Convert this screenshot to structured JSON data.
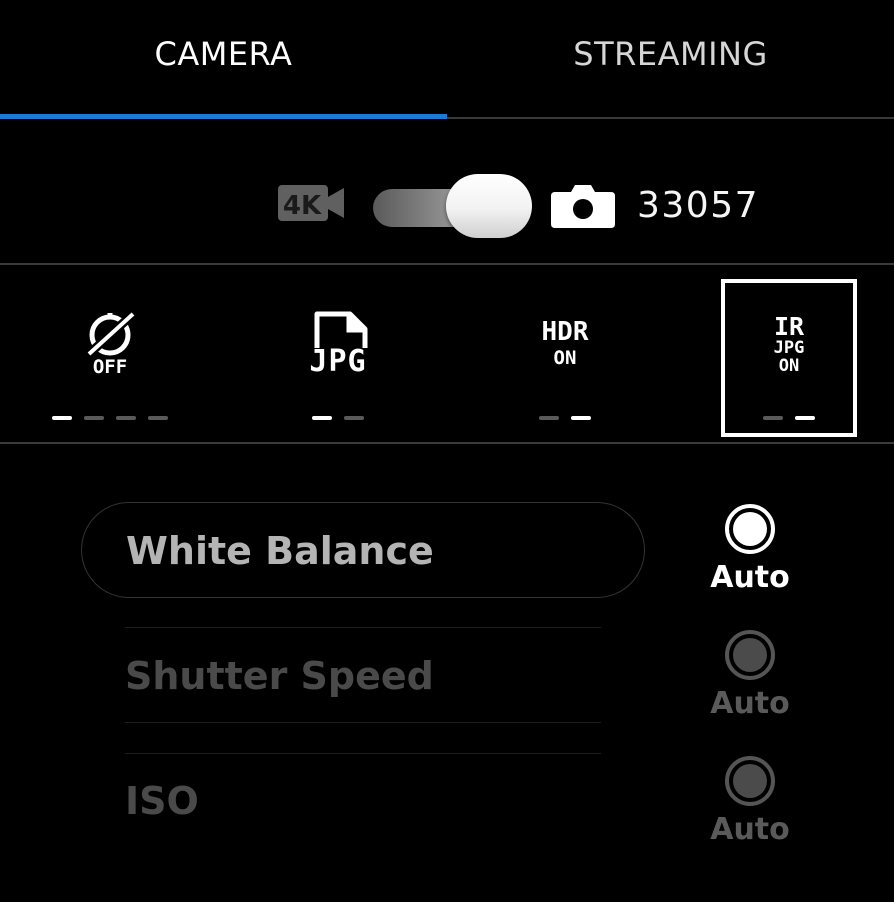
{
  "tabs": [
    {
      "label": "CAMERA",
      "active": true
    },
    {
      "label": "STREAMING",
      "active": false
    }
  ],
  "accent_color": "#1f7ad6",
  "mode": {
    "video_icon_label": "4K",
    "current": "photo",
    "shot_count": "33057"
  },
  "settings": [
    {
      "icon": "timer-off-icon",
      "line1": "OFF",
      "dots": [
        true,
        false,
        false,
        false
      ]
    },
    {
      "icon": "jpg-file-icon",
      "line1": "JPG",
      "dots": [
        true,
        false
      ]
    },
    {
      "icon": "hdr-icon",
      "line1": "HDR",
      "line2": "ON",
      "dots": [
        false,
        true
      ]
    },
    {
      "icon": "ir-jpg-icon",
      "line1": "IR",
      "line2": "JPG",
      "line3": "ON",
      "dots": [
        false,
        true
      ],
      "selected": true
    }
  ],
  "params": [
    {
      "label": "White Balance",
      "value": "Auto",
      "active": true
    },
    {
      "label": "Shutter Speed",
      "value": "Auto",
      "active": false
    },
    {
      "label": "ISO",
      "value": "Auto",
      "active": false
    }
  ]
}
